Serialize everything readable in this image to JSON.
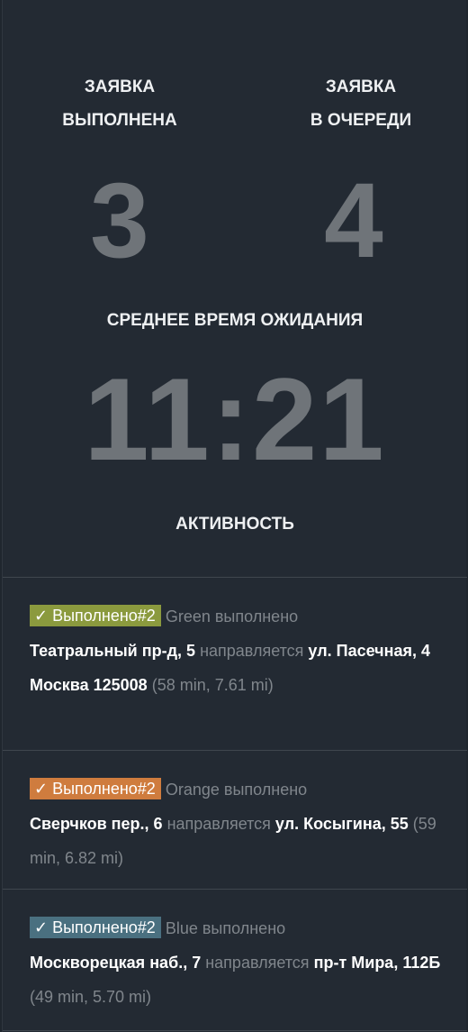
{
  "stats": {
    "completed_label": "ЗАЯВКА\nВЫПОЛНЕНА",
    "completed_value": "3",
    "queue_label": "ЗАЯВКА\nВ ОЧЕРЕДИ",
    "queue_value": "4",
    "avg_label": "СРЕДНЕЕ ВРЕМЯ ОЖИДАНИЯ",
    "avg_value": "11:21"
  },
  "activity": {
    "heading": "АКТИВНОСТЬ",
    "items": [
      {
        "badge": "✓ Выполнено#2",
        "badge_color": "#8b9a3e",
        "status": "Green выполнено",
        "from": "Театральный пр-д, 5",
        "verb": "направляется",
        "to": "ул. Пасечная, 4 Москва 125008",
        "meta": "(58 min, 7.61 mi)"
      },
      {
        "badge": "✓ Выполнено#2",
        "badge_color": "#cf7c3e",
        "status": "Orange выполнено",
        "from": "Сверчков пер., 6",
        "verb": "направляется",
        "to": "ул. Косыгина, 55",
        "meta": "(59 min, 6.82 mi)"
      },
      {
        "badge": "✓ Выполнено#2",
        "badge_color": "#4a7080",
        "status": "Blue выполнено",
        "from": "Москворецкая наб., 7",
        "verb": "направляется",
        "to": "пр-т Мира, 112Б",
        "meta": "(49 min, 5.70 mi)"
      }
    ]
  }
}
